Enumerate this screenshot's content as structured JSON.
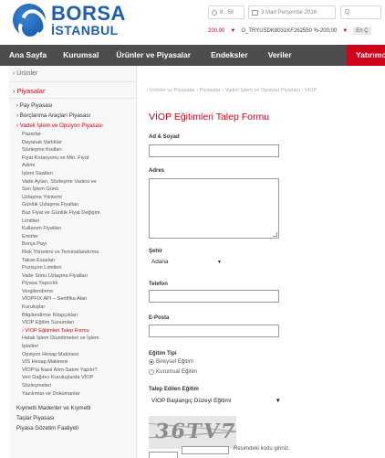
{
  "header": {
    "logo_line1": "BORSA",
    "logo_line2": "İSTANBUL",
    "time": "8 : 58",
    "date": "3 Mart Perşembe 2016",
    "search_placeholder": "Q",
    "ticker": {
      "value1": "200,00",
      "symbol": "O_TRYUSDK8031KF262550 %-200,00",
      "chip": "En Ç"
    }
  },
  "nav": {
    "items": [
      "Ana Sayfa",
      "Kurumsal",
      "Ürünler ve Piyasalar",
      "Endeksler",
      "Veriler"
    ],
    "active_label": "Yatırımc"
  },
  "sidebar": {
    "top": "Ürünler",
    "section": "Piyasalar",
    "items": [
      {
        "label": "Pay Piyasası",
        "level": 1,
        "active": false
      },
      {
        "label": "Borçlanma Araçları Piyasası",
        "level": 1,
        "active": false
      },
      {
        "label": "Vadeli İşlem ve Opsiyon Piyasası",
        "level": 1,
        "active": true
      },
      {
        "label": "Pazarlar",
        "level": 2,
        "active": false
      },
      {
        "label": "Dayanak Varlıklar",
        "level": 2,
        "active": false
      },
      {
        "label": "Sözleşme Kodları",
        "level": 2,
        "active": false
      },
      {
        "label": "Fiyat Kotasyonu ve Min. Fiyat",
        "level": 2,
        "active": false
      },
      {
        "label": "Adımı",
        "level": 2,
        "active": false
      },
      {
        "label": "İşlem Saatleri",
        "level": 2,
        "active": false
      },
      {
        "label": "Vade Ayları, Sözleşme Vadesi ve",
        "level": 2,
        "active": false
      },
      {
        "label": "Son İşlem Günü",
        "level": 2,
        "active": false
      },
      {
        "label": "Uzlaşma Yöntemi",
        "level": 2,
        "active": false
      },
      {
        "label": "Günlük Uzlaşma Fiyatları",
        "level": 2,
        "active": false
      },
      {
        "label": "Baz Fiyat ve Günlük Fiyat Değişim",
        "level": 2,
        "active": false
      },
      {
        "label": "Limitleri",
        "level": 2,
        "active": false
      },
      {
        "label": "Kullanım Fiyatları",
        "level": 2,
        "active": false
      },
      {
        "label": "Emirler",
        "level": 2,
        "active": false
      },
      {
        "label": "Borça Payı",
        "level": 2,
        "active": false
      },
      {
        "label": "Risk Yönetimi ve Teminatlandırma",
        "level": 2,
        "active": false
      },
      {
        "label": "Takas Esasları",
        "level": 2,
        "active": false
      },
      {
        "label": "Pozisyon Limitleri",
        "level": 2,
        "active": false
      },
      {
        "label": "Vade Sonu Uzlaşma Fiyatları",
        "level": 2,
        "active": false
      },
      {
        "label": "Piyasa Yapıcılık",
        "level": 2,
        "active": false
      },
      {
        "label": "Vergilendirme",
        "level": 2,
        "active": false
      },
      {
        "label": "VİOPFIX API – Sertifika Alan",
        "level": 2,
        "active": false
      },
      {
        "label": "Kuruluşlar",
        "level": 2,
        "active": false
      },
      {
        "label": "Bilgilendirme Kitapçıkları",
        "level": 2,
        "active": false
      },
      {
        "label": "VİOP Eğitim Sunumları",
        "level": 2,
        "active": false
      },
      {
        "label": "VİOP Eğitimleri Talep Formu",
        "level": 2,
        "active": true
      },
      {
        "label": "Hatalı İşlem Düzeltmeleri ve İşlem",
        "level": 2,
        "active": false
      },
      {
        "label": "İptalleri",
        "level": 2,
        "active": false
      },
      {
        "label": "Opsiyon Hesap Makinesi",
        "level": 2,
        "active": false
      },
      {
        "label": "VIS Hesap Makinesi",
        "level": 2,
        "active": false
      },
      {
        "label": "VİOP'ta Nasıl Alım-Satım Yapılır?",
        "level": 2,
        "active": false
      },
      {
        "label": "Veri Dağıtıcı Kuruluşlarda VİOP",
        "level": 2,
        "active": false
      },
      {
        "label": "Sözleşmeleri",
        "level": 2,
        "active": false
      },
      {
        "label": "Yazılımlar ve Dokümanlar",
        "level": 2,
        "active": false
      }
    ],
    "bottom_items": [
      "Kıymetli Madenler ve Kıymetli",
      "Taşlar Piyasası",
      "Piyasa Gözetim Faaliyeti"
    ]
  },
  "main": {
    "breadcrumb": "›  Ürünler ve Piyasalar  ›  Piyasalar  ›  Vadeli İşlem ve Opsiyon Piyasası  ›  VİOP",
    "title": "VİOP Eğitimleri Talep Formu",
    "labels": {
      "name": "Ad & Soyad",
      "address": "Adres",
      "city": "Şehir",
      "phone": "Telefon",
      "email": "E-Posta",
      "training_type": "Eğitim Tipi",
      "requested": "Talep Edilen Eğitim"
    },
    "city_value": "Adana",
    "radio_options": [
      "Bireysel Eğitim",
      "Kurumsal Eğitim"
    ],
    "requested_value": "VİOP Başlangıç Düzeyi Eğitimi",
    "captcha_text": "36TV7",
    "captcha_hint": "Resimdeki kodu giriniz."
  }
}
